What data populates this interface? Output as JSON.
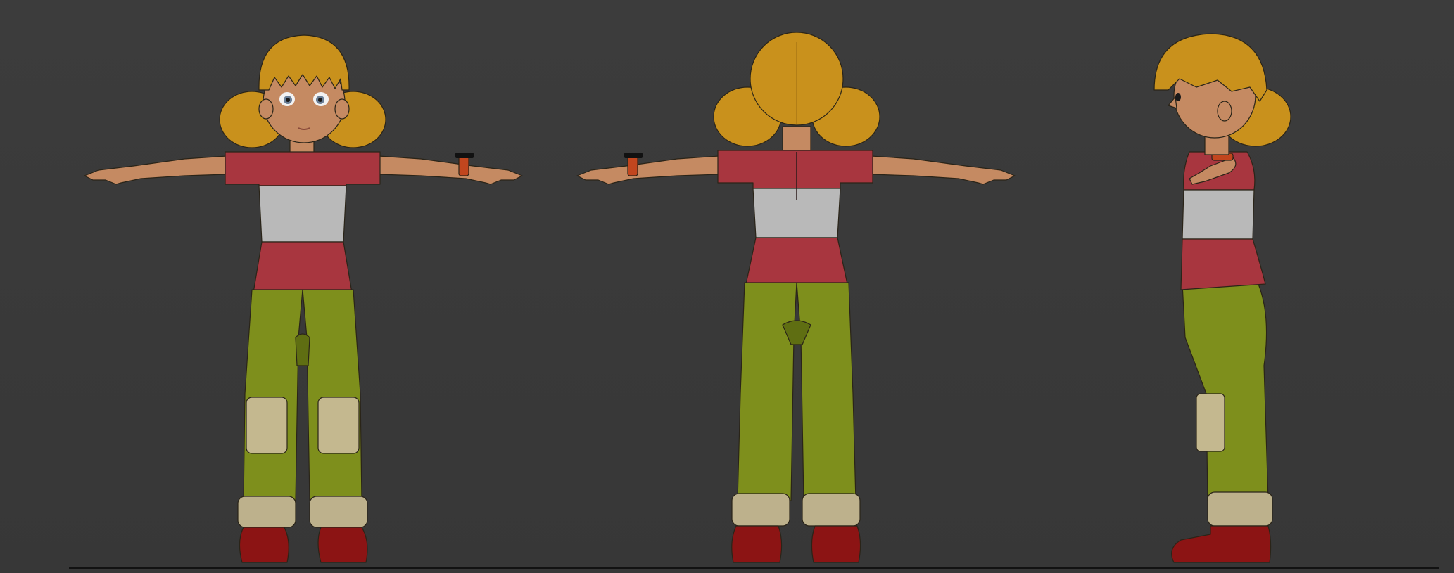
{
  "viewport": {
    "background": "#3a3a3a",
    "views": [
      "front",
      "back",
      "side"
    ]
  },
  "colors": {
    "hair": "#c9911c",
    "hair_shade": "#9c6c10",
    "skin": "#c58a62",
    "skin_shade": "#a26c48",
    "shirt_red": "#a8363f",
    "shirt_white": "#b9b9b9",
    "pants": "#7e8f1c",
    "pants_shade": "#5f6e12",
    "patch": "#c4b88f",
    "cuff": "#bdb18c",
    "shoe": "#8c1414",
    "wristband": "#c2461e",
    "eye": "#6b7f96",
    "ground_line": "#121212"
  }
}
